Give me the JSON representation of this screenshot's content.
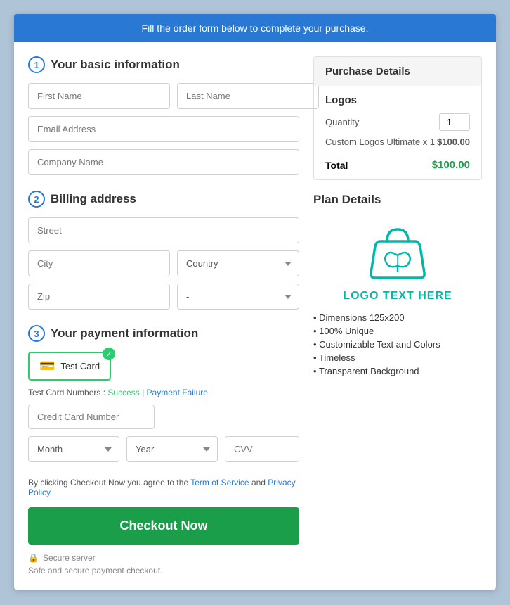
{
  "banner": {
    "text": "Fill the order form below to complete your purchase."
  },
  "form": {
    "section1": {
      "number": "1",
      "title": "Your basic information",
      "firstName": {
        "placeholder": "First Name"
      },
      "lastName": {
        "placeholder": "Last Name"
      },
      "email": {
        "placeholder": "Email Address"
      },
      "company": {
        "placeholder": "Company Name"
      }
    },
    "section2": {
      "number": "2",
      "title": "Billing address",
      "street": {
        "placeholder": "Street"
      },
      "city": {
        "placeholder": "City"
      },
      "country": {
        "placeholder": "Country"
      },
      "zip": {
        "placeholder": "Zip"
      },
      "state": {
        "placeholder": "-"
      }
    },
    "section3": {
      "number": "3",
      "title": "Your payment information",
      "cardLabel": "Test Card",
      "testCardText": "Test Card Numbers :",
      "successLink": "Success",
      "failLink": "Payment Failure",
      "creditCardPlaceholder": "Credit Card Number",
      "monthPlaceholder": "Month",
      "yearPlaceholder": "Year",
      "cvvPlaceholder": "CVV"
    },
    "termsText": "By clicking Checkout Now you agree to the",
    "termsLink": "Term of Service",
    "andText": "and",
    "privacyLink": "Privacy Policy",
    "checkoutBtn": "Checkout Now",
    "secureLabel": "Secure server",
    "safeText": "Safe and secure payment checkout."
  },
  "purchaseDetails": {
    "header": "Purchase Details",
    "section": "Logos",
    "quantityLabel": "Quantity",
    "quantityValue": "1",
    "productName": "Custom Logos Ultimate x 1",
    "productPrice": "$100.00",
    "totalLabel": "Total",
    "totalValue": "$100.00"
  },
  "planDetails": {
    "title": "Plan Details",
    "logoText": "LOGO TEXT HERE",
    "features": [
      "Dimensions 125x200",
      "100% Unique",
      "Customizable Text and Colors",
      "Timeless",
      "Transparent Background"
    ]
  }
}
